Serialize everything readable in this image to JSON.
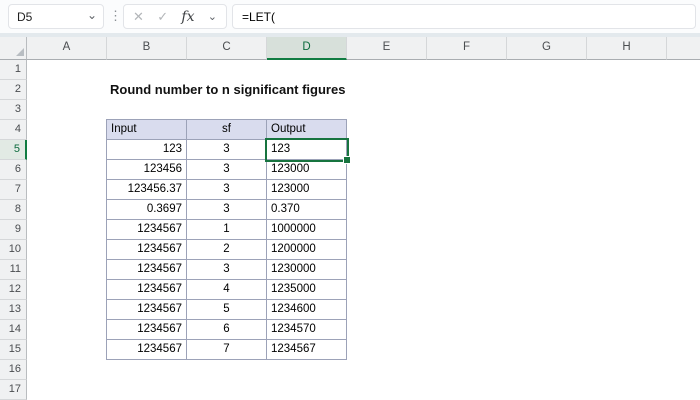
{
  "formula_bar": {
    "name_box_value": "D5",
    "formula": "=LET(",
    "fx_label": "fx",
    "icons": {
      "name_box_dropdown": "⌄",
      "menu_dots": "⋮",
      "cancel": "✕",
      "enter": "✓",
      "fx_dropdown": "⌄"
    }
  },
  "grid": {
    "column_headers": [
      "A",
      "B",
      "C",
      "D",
      "E",
      "F",
      "G",
      "H"
    ],
    "row_headers": [
      "1",
      "2",
      "3",
      "4",
      "5",
      "6",
      "7",
      "8",
      "9",
      "10",
      "11",
      "12",
      "13",
      "14",
      "15",
      "16",
      "17"
    ]
  },
  "selection": {
    "active_cell": "D5",
    "selected_column": "D",
    "selected_row": "5"
  },
  "sheet": {
    "title": "Round number to n significant figures"
  },
  "table": {
    "headers": [
      "Input",
      "sf",
      "Output"
    ],
    "rows": [
      {
        "input": "123",
        "sf": "3",
        "output": "123"
      },
      {
        "input": "123456",
        "sf": "3",
        "output": "123000"
      },
      {
        "input": "123456.37",
        "sf": "3",
        "output": "123000"
      },
      {
        "input": "0.3697",
        "sf": "3",
        "output": "0.370"
      },
      {
        "input": "1234567",
        "sf": "1",
        "output": "1000000"
      },
      {
        "input": "1234567",
        "sf": "2",
        "output": "1200000"
      },
      {
        "input": "1234567",
        "sf": "3",
        "output": "1230000"
      },
      {
        "input": "1234567",
        "sf": "4",
        "output": "1235000"
      },
      {
        "input": "1234567",
        "sf": "5",
        "output": "1234600"
      },
      {
        "input": "1234567",
        "sf": "6",
        "output": "1234570"
      },
      {
        "input": "1234567",
        "sf": "7",
        "output": "1234567"
      }
    ]
  },
  "colors": {
    "accent_green": "#107C41",
    "selected_header_text": "#0C6B3D",
    "table_header_fill": "#D9DCEE",
    "table_border": "#9CA2B8",
    "header_bar_bg": "#F0F1F2"
  }
}
